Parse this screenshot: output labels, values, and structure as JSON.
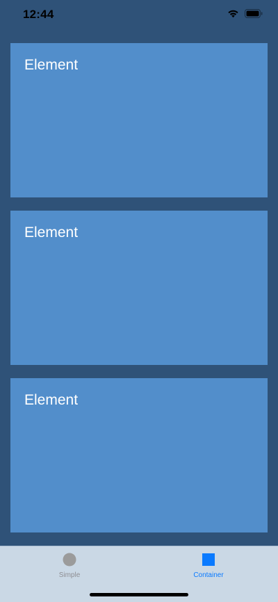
{
  "status_bar": {
    "time": "12:44",
    "icons": [
      "wifi-icon",
      "battery-icon"
    ]
  },
  "cards": [
    {
      "title": "Element"
    },
    {
      "title": "Element"
    },
    {
      "title": "Element"
    }
  ],
  "tab_bar": {
    "selected": "Container",
    "tabs": [
      {
        "label": "Simple",
        "icon": "circle-icon",
        "color": "#9b9b9b"
      },
      {
        "label": "Container",
        "icon": "square-icon",
        "color": "#0a7aff"
      }
    ]
  },
  "colors": {
    "background": "#2f5278",
    "card": "#528ecb",
    "tab_bar": "#cad8e5",
    "accent": "#0a7aff"
  }
}
